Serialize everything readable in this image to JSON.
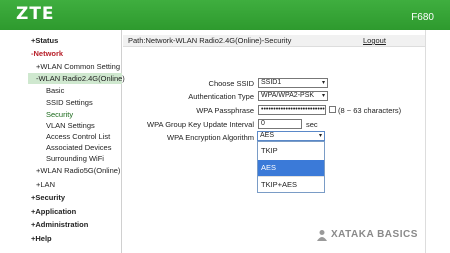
{
  "header": {
    "brand": "ZTE",
    "model": "F680"
  },
  "sidebar": {
    "items": [
      {
        "label": "Status",
        "prefix": "+"
      },
      {
        "label": "Network",
        "prefix": "-"
      },
      {
        "label": "WLAN Common Setting",
        "prefix": "+"
      },
      {
        "label": "WLAN Radio2.4G(Online)",
        "prefix": "-"
      },
      {
        "label": "Basic"
      },
      {
        "label": "SSID Settings"
      },
      {
        "label": "Security"
      },
      {
        "label": "VLAN Settings"
      },
      {
        "label": "Access Control List"
      },
      {
        "label": "Associated Devices"
      },
      {
        "label": "Surrounding WiFi"
      },
      {
        "label": "WLAN Radio5G(Online)",
        "prefix": "+"
      },
      {
        "label": "LAN",
        "prefix": "+"
      },
      {
        "label": "Security",
        "prefix": "+"
      },
      {
        "label": "Application",
        "prefix": "+"
      },
      {
        "label": "Administration",
        "prefix": "+"
      },
      {
        "label": "Help",
        "prefix": "+"
      }
    ]
  },
  "breadcrumb": "Path:Network-WLAN Radio2.4G(Online)-Security",
  "logout": "Logout",
  "form": {
    "choose_ssid_label": "Choose SSID",
    "choose_ssid_value": "SSID1",
    "auth_type_label": "Authentication Type",
    "auth_type_value": "WPA/WPA2-PSK",
    "passphrase_label": "WPA Passphrase",
    "passphrase_value": "••••••••••••••••••••••••••",
    "passphrase_hint": "(8 ~ 63 characters)",
    "group_key_label": "WPA Group Key Update Interval",
    "group_key_value": "0",
    "group_key_unit": "sec",
    "encryption_label": "WPA Encryption Algorithm",
    "encryption_value": "AES",
    "encryption_options": [
      "TKIP",
      "AES",
      "TKIP+AES"
    ],
    "encryption_selected": "AES"
  },
  "watermark": "XATAKA BASICS",
  "colors": {
    "header_green": "#36a436",
    "network_red": "#b8202a",
    "selected_blue": "#3b7ad8"
  },
  "icons": {
    "dropdown_caret": "▾"
  }
}
